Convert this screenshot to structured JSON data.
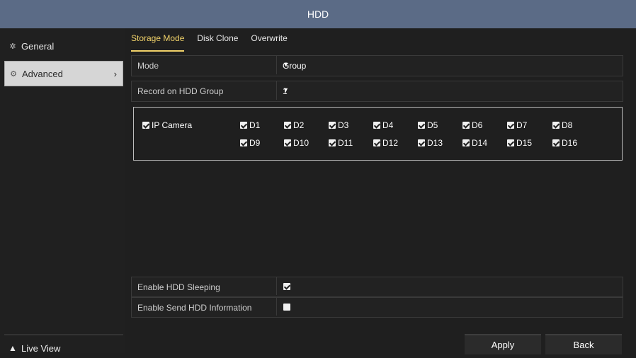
{
  "window": {
    "title": "HDD"
  },
  "sidebar": {
    "items": [
      {
        "label": "General",
        "icon": "gear-icon"
      },
      {
        "label": "Advanced",
        "icon": "settings-icon"
      }
    ],
    "live_view": "Live View"
  },
  "tabs": [
    "Storage Mode",
    "Disk Clone",
    "Overwrite"
  ],
  "form": {
    "mode": {
      "label": "Mode",
      "value": "Group"
    },
    "hdd_group": {
      "label": "Record on HDD Group",
      "value": "1"
    }
  },
  "cameras": {
    "master_label": "IP Camera",
    "master_checked": true,
    "channels": [
      {
        "label": "D1",
        "checked": true
      },
      {
        "label": "D2",
        "checked": true
      },
      {
        "label": "D3",
        "checked": true
      },
      {
        "label": "D4",
        "checked": true
      },
      {
        "label": "D5",
        "checked": true
      },
      {
        "label": "D6",
        "checked": true
      },
      {
        "label": "D7",
        "checked": true
      },
      {
        "label": "D8",
        "checked": true
      },
      {
        "label": "D9",
        "checked": true
      },
      {
        "label": "D10",
        "checked": true
      },
      {
        "label": "D11",
        "checked": true
      },
      {
        "label": "D12",
        "checked": true
      },
      {
        "label": "D13",
        "checked": true
      },
      {
        "label": "D14",
        "checked": true
      },
      {
        "label": "D15",
        "checked": true
      },
      {
        "label": "D16",
        "checked": true
      }
    ]
  },
  "options": {
    "hdd_sleeping": {
      "label": "Enable HDD Sleeping",
      "checked": true
    },
    "send_hdd_info": {
      "label": "Enable Send HDD Information",
      "checked": false
    }
  },
  "buttons": {
    "apply": "Apply",
    "back": "Back"
  },
  "colors": {
    "titlebar": "#5b6b86",
    "active_tab": "#f2d36a",
    "background": "#1f1f1f"
  }
}
